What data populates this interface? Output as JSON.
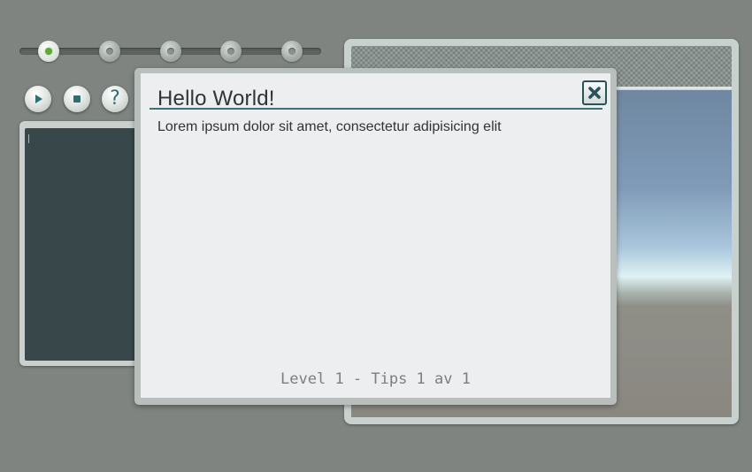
{
  "progress": {
    "steps": [
      {
        "state": "active"
      },
      {
        "state": "inactive"
      },
      {
        "state": "inactive"
      },
      {
        "state": "inactive"
      },
      {
        "state": "inactive"
      }
    ]
  },
  "controls": [
    {
      "icon": "play-icon"
    },
    {
      "icon": "stop-icon"
    },
    {
      "icon": "help-icon",
      "glyph": "?"
    }
  ],
  "dialog": {
    "title": "Hello World!",
    "body": "Lorem ipsum dolor sit amet, consectetur adipisicing elit",
    "footer": "Level 1 - Tips 1 av 1",
    "close_icon": "close-icon"
  },
  "colors": {
    "background": "#7f8480",
    "accent": "#3d7376",
    "active_step": "#5fa83a",
    "code_background": "#37474a"
  }
}
